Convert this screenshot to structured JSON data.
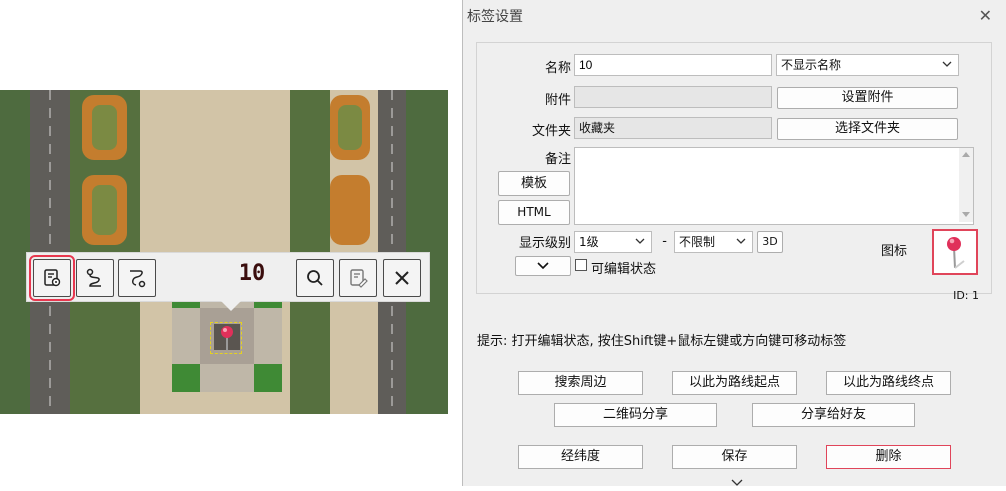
{
  "map": {
    "toolbar": {
      "title": "10",
      "icons": [
        "label-settings-icon",
        "route-start-icon",
        "route-end-icon",
        "search-icon",
        "edit-note-icon",
        "close-icon"
      ]
    },
    "colors": {
      "highlight": "#e8374f",
      "pin": "#e0305a"
    }
  },
  "dialog": {
    "title": "标签设置",
    "name": {
      "label": "名称",
      "value": "10",
      "display_option": "不显示名称"
    },
    "attachment": {
      "label": "附件",
      "value": "",
      "button": "设置附件"
    },
    "folder": {
      "label": "文件夹",
      "value": "收藏夹",
      "button": "选择文件夹"
    },
    "note": {
      "label": "备注",
      "template_button": "模板",
      "html_button": "HTML",
      "value": ""
    },
    "level": {
      "label": "显示级别",
      "min": "1级",
      "separator": "-",
      "max": "不限制",
      "three_d": "3D"
    },
    "editable": {
      "label": "可编辑状态",
      "checked": false
    },
    "icon": {
      "label": "图标"
    },
    "id_text": "ID: 1",
    "hint": "提示: 打开编辑状态, 按住Shift键+鼠标左键或方向键可移动标签",
    "buttons": {
      "search_nearby": "搜索周边",
      "route_start": "以此为路线起点",
      "route_end": "以此为路线终点",
      "qr_share": "二维码分享",
      "share_friend": "分享给好友",
      "coords": "经纬度",
      "save": "保存",
      "delete": "删除"
    }
  }
}
